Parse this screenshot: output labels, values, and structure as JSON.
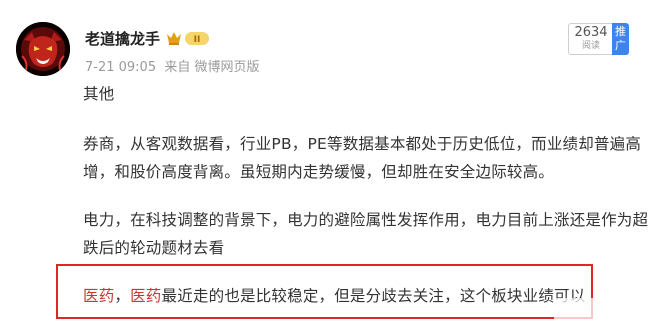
{
  "post": {
    "username": "老道擒龙手",
    "badge_level": "II",
    "timestamp": "7-21 09:05",
    "source_prefix": "来自",
    "source": "微博网页版",
    "read_count": "2634",
    "read_label": "阅读",
    "promote_label": [
      "推",
      "广"
    ]
  },
  "content": {
    "p1": "其他",
    "p2": "券商，从客观数据看，行业PB，PE等数据基本都处于历史低位，而业绩却普遍高增，和股价高度背离。虽短期内走势缓慢，但却胜在安全边际较高。",
    "p3": "电力，在科技调整的背景下，电力的避险属性发挥作用，电力目前上涨还是作为超跌后的轮动题材去看",
    "p4_kw1": "医药",
    "p4_sep": "，",
    "p4_kw2": "医药",
    "p4_rest": "最近走的也是比较稳定，但是分歧去关注，这个板块业绩可以"
  },
  "colors": {
    "keyword": "#c9372c",
    "highlight_border": "#e0262a",
    "promote_bg": "#3f83ee"
  }
}
